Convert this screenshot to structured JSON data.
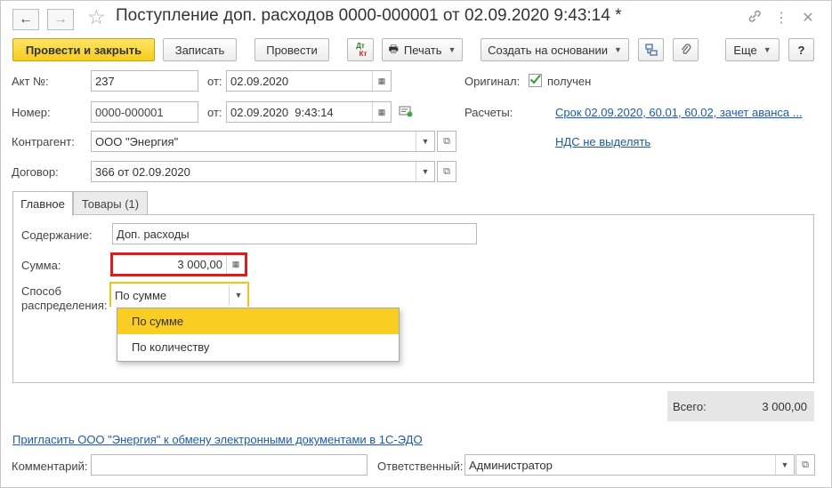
{
  "window": {
    "title": "Поступление доп. расходов 0000-000001 от 02.09.2020 9:43:14 *"
  },
  "toolbar": {
    "post_close": "Провести и закрыть",
    "save": "Записать",
    "post": "Провести",
    "dtkt_top": "Дт",
    "dtkt_bottom": "Кт",
    "print": "Печать",
    "create_based": "Создать на основании",
    "more": "Еще",
    "help": "?"
  },
  "header": {
    "act_label": "Акт №:",
    "act_value": "237",
    "from_label": "от:",
    "act_date": "02.09.2020",
    "number_label": "Номер:",
    "number_value": "0000-000001",
    "doc_date": "02.09.2020  9:43:14",
    "counterparty_label": "Контрагент:",
    "counterparty_value": "ООО \"Энергия\"",
    "contract_label": "Договор:",
    "contract_value": "366 от 02.09.2020",
    "original_label": "Оригинал:",
    "original_checked": true,
    "original_value": "получен",
    "settlements_label": "Расчеты:",
    "settlements_link": "Срок 02.09.2020, 60.01, 60.02, зачет аванса ...",
    "vat_link": "НДС не выделять"
  },
  "tabs": [
    {
      "label": "Главное",
      "active": true
    },
    {
      "label": "Товары (1)",
      "active": false
    }
  ],
  "main": {
    "content_label": "Содержание:",
    "content_value": "Доп. расходы",
    "sum_label": "Сумма:",
    "sum_value": "3 000,00",
    "method_label_1": "Способ",
    "method_label_2": "распределения:",
    "method_value": "По сумме",
    "options": [
      "По сумме",
      "По количеству"
    ],
    "selected_option": 0
  },
  "total": {
    "label": "Всего:",
    "value": "3 000,00"
  },
  "footer": {
    "invite_link": "Пригласить ООО \"Энергия\" к обмену электронными документами в 1С-ЭДО",
    "comment_label": "Комментарий:",
    "comment_value": "",
    "responsible_label": "Ответственный:",
    "responsible_value": "Администратор"
  },
  "colors": {
    "primary_button": "#f4cc1d",
    "highlight_border": "#d81e1e",
    "focus_border": "#f2c21a",
    "link": "#1c5ba5",
    "dropdown_selected": "#f9cd24"
  }
}
